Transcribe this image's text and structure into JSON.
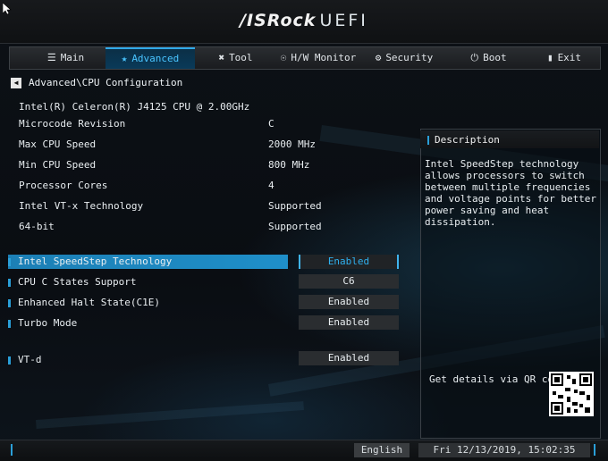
{
  "header": {
    "brand": "/ISRock",
    "product": "UEFI"
  },
  "tabs": [
    {
      "label": "Main",
      "icon": "list-icon"
    },
    {
      "label": "Advanced",
      "icon": "star-icon"
    },
    {
      "label": "Tool",
      "icon": "tools-icon"
    },
    {
      "label": "H/W Monitor",
      "icon": "monitor-icon"
    },
    {
      "label": "Security",
      "icon": "shield-icon"
    },
    {
      "label": "Boot",
      "icon": "power-icon"
    },
    {
      "label": "Exit",
      "icon": "exit-icon"
    }
  ],
  "active_tab": "Advanced",
  "breadcrumb": "Advanced\\CPU Configuration",
  "cpu_model": "Intel(R) Celeron(R) J4125 CPU @ 2.00GHz",
  "info": [
    {
      "label": "Microcode Revision",
      "value": "C"
    },
    {
      "label": "Max CPU Speed",
      "value": "2000 MHz"
    },
    {
      "label": "Min CPU Speed",
      "value": "800 MHz"
    },
    {
      "label": "Processor Cores",
      "value": "4"
    },
    {
      "label": "Intel VT-x Technology",
      "value": "Supported"
    },
    {
      "label": "64-bit",
      "value": "Supported"
    }
  ],
  "options": [
    {
      "label": "Intel SpeedStep Technology",
      "value": "Enabled",
      "selected": true
    },
    {
      "label": "CPU C States Support",
      "value": "C6"
    },
    {
      "label": "Enhanced Halt State(C1E)",
      "value": "Enabled"
    },
    {
      "label": "Turbo Mode",
      "value": "Enabled"
    },
    {
      "label": "VT-d",
      "value": "Enabled"
    }
  ],
  "description": {
    "title": "Description",
    "text": "Intel SpeedStep technology allows processors to switch between multiple frequencies and voltage points for better power saving and heat dissipation.",
    "qr_text": "Get details via QR code"
  },
  "footer": {
    "language": "English",
    "datetime": "Fri 12/13/2019, 15:02:35"
  },
  "colors": {
    "accent": "#2fa8e8",
    "selection": "#1f8fc9",
    "background": "#0b0f14"
  }
}
